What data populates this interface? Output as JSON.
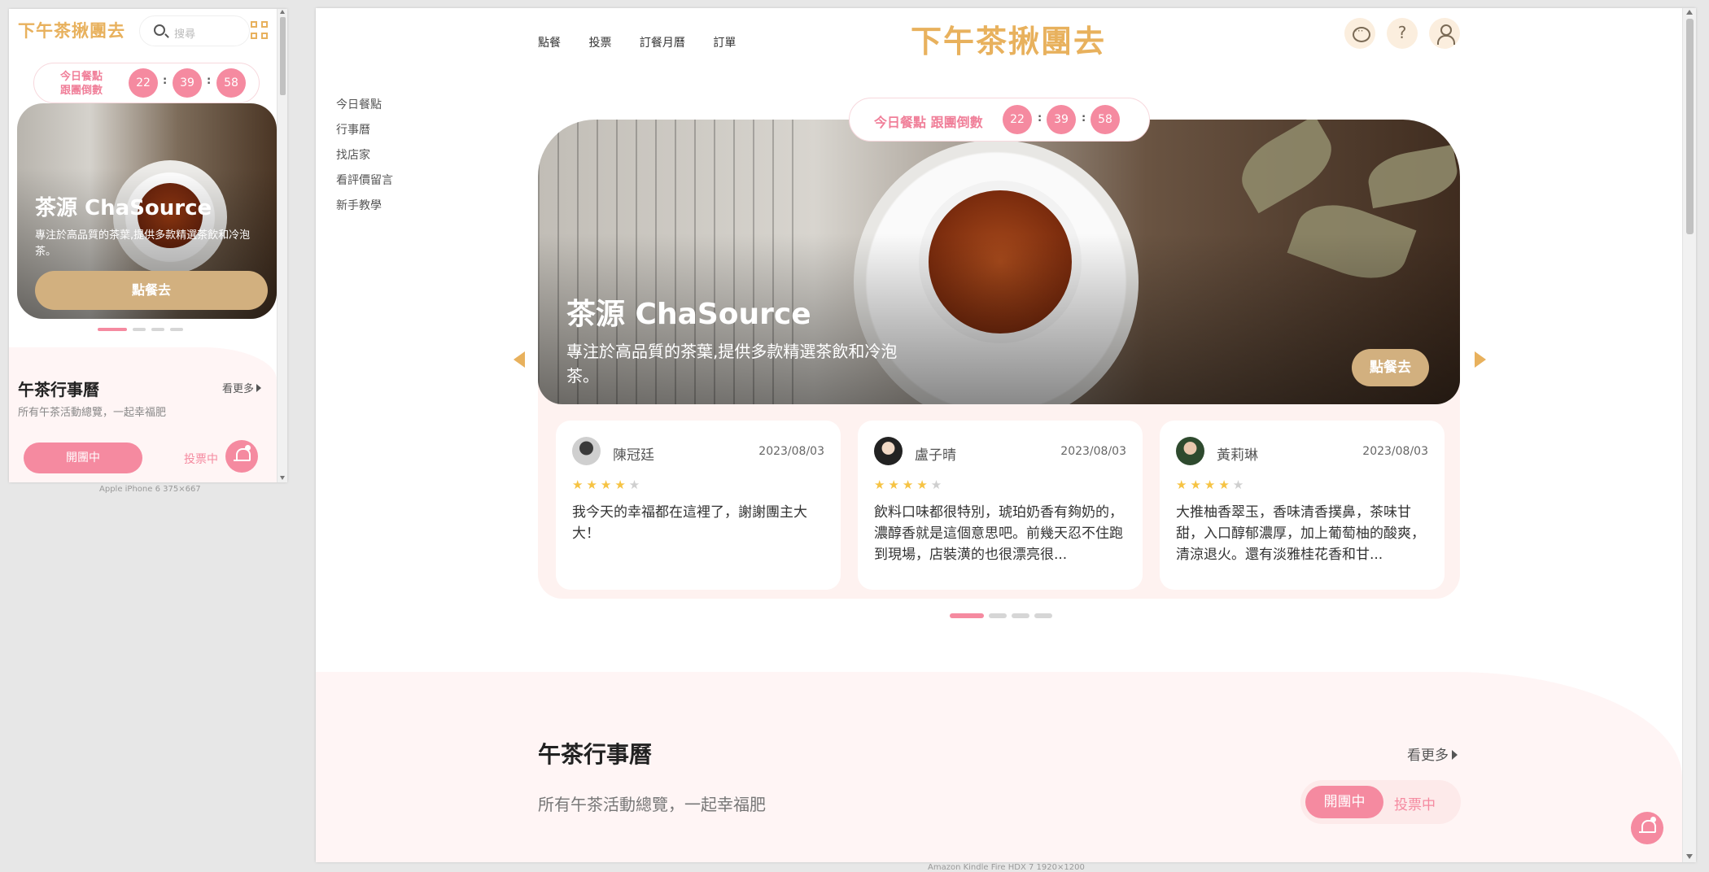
{
  "brand": "下午茶揪團去",
  "search": {
    "placeholder": "搜尋"
  },
  "countdown": {
    "label_mobile": "今日餐點\n跟團倒數",
    "label_desktop": "今日餐點 跟團倒數",
    "hours": "22",
    "minutes": "39",
    "seconds": "58",
    "sep": ":"
  },
  "nav": [
    "點餐",
    "投票",
    "訂餐月曆",
    "訂單"
  ],
  "side_menu": [
    "今日餐點",
    "行事曆",
    "找店家",
    "看評價留言",
    "新手教學"
  ],
  "hero": {
    "title": "茶源 ChaSource",
    "desc": "專注於高品質的茶葉,提供多款精選茶飲和冷泡茶。",
    "button": "點餐去"
  },
  "reviews": [
    {
      "name": "陳冠廷",
      "date": "2023/08/03",
      "rating": 4,
      "text": "我今天的幸福都在這裡了，謝謝團主大大！"
    },
    {
      "name": "盧子晴",
      "date": "2023/08/03",
      "rating": 4,
      "text": "飲料口味都很特別，琥珀奶香有夠奶的，濃醇香就是這個意思吧。前幾天忍不住跑到現場，店裝潢的也很漂亮很..."
    },
    {
      "name": "黃莉琳",
      "date": "2023/08/03",
      "rating": 4,
      "text": "大推柚香翠玉，香味清香撲鼻，茶味甘甜，入口醇郁濃厚，加上葡萄柚的酸爽，清涼退火。還有淡雅桂花香和甘..."
    }
  ],
  "calendar": {
    "title": "午茶行事曆",
    "more": "看更多",
    "subtitle": "所有午茶活動總覽，一起幸福肥",
    "tab_open": "開團中",
    "tab_vote": "投票中"
  },
  "captions": {
    "phone": "Apple iPhone 6   375×667",
    "tablet": "Amazon Kindle Fire HDX 7   1920×1200"
  },
  "colors": {
    "brand_gold": "#e8b15d",
    "pink": "#f58aa0",
    "button_tan": "#d2b07f",
    "section_bg": "#fff5f5"
  },
  "icons": [
    "search-icon",
    "grid-menu-icon",
    "chat-icon",
    "help-icon",
    "user-icon",
    "bell-icon",
    "chevron-left-icon",
    "chevron-right-icon",
    "star-icon"
  ],
  "carousel": {
    "slides": 4,
    "active": 1
  }
}
